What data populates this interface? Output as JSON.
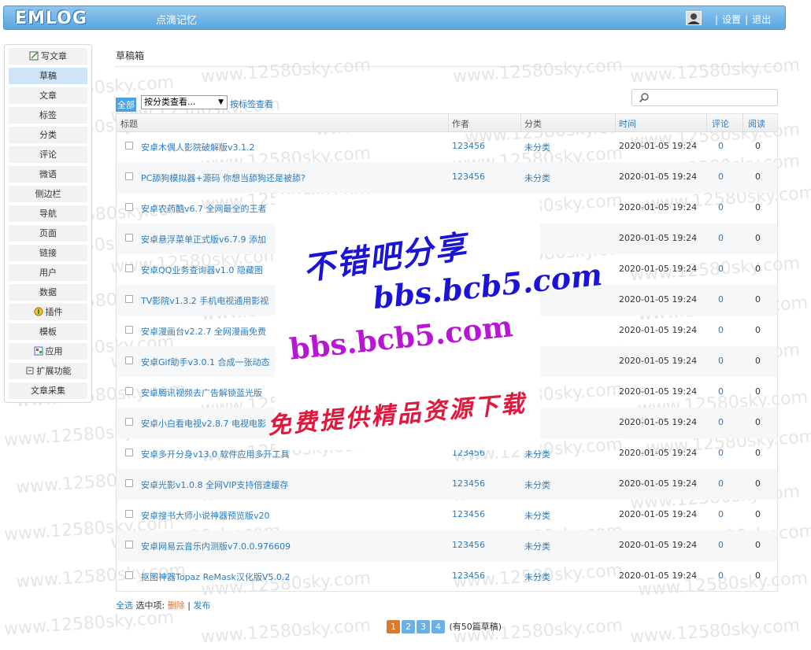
{
  "header": {
    "logo": "EMLOG",
    "site_name": "点滴记忆",
    "settings": "设置",
    "logout": "退出",
    "sep": "|"
  },
  "sidebar": {
    "items": [
      {
        "label": "写文章",
        "icon": "write-icon"
      },
      {
        "label": "草稿",
        "active": true
      },
      {
        "label": "文章"
      },
      {
        "label": "标签"
      },
      {
        "label": "分类"
      },
      {
        "label": "评论"
      },
      {
        "label": "微语"
      },
      {
        "label": "侧边栏"
      },
      {
        "label": "导航"
      },
      {
        "label": "页面"
      },
      {
        "label": "链接"
      },
      {
        "label": "用户"
      },
      {
        "label": "数据"
      },
      {
        "label": "插件",
        "icon": "plugin-icon"
      },
      {
        "label": "模板"
      },
      {
        "label": "应用",
        "icon": "app-icon"
      },
      {
        "label": "扩展功能",
        "icon": "collapse-icon"
      },
      {
        "label": "文章采集"
      }
    ]
  },
  "main": {
    "page_title": "草稿箱",
    "filter": {
      "all": "全部",
      "category_select": "按分类查看...",
      "tag_view": "按标签查看"
    },
    "table": {
      "headers": [
        "标题",
        "作者",
        "分类",
        "时间",
        "评论",
        "阅读"
      ],
      "rows": [
        {
          "title": "安卓木偶人影院破解版v3.1.2",
          "author": "123456",
          "category": "未分类",
          "time": "2020-01-05 19:24",
          "comments": "0",
          "views": "0"
        },
        {
          "title": "PC舔狗模拟器+源码 你想当舔狗还是被舔?",
          "author": "123456",
          "category": "未分类",
          "time": "2020-01-05 19:24",
          "comments": "0",
          "views": "0"
        },
        {
          "title": "安卓农药酷v6.7 全网最全的王者",
          "author": "",
          "category": "类",
          "time": "2020-01-05 19:24",
          "comments": "0",
          "views": "0"
        },
        {
          "title": "安卓悬浮菜单正式版v6.7.9 添加",
          "author": "",
          "category": "类",
          "time": "2020-01-05 19:24",
          "comments": "0",
          "views": "0"
        },
        {
          "title": "安卓QQ业务查询器v1.0 隐藏图",
          "author": "",
          "category": "类",
          "time": "2020-01-05 19:24",
          "comments": "0",
          "views": "0"
        },
        {
          "title": "TV影院v1.3.2 手机电视通用影视",
          "author": "",
          "category": "类",
          "time": "2020-01-05 19:24",
          "comments": "0",
          "views": "0"
        },
        {
          "title": "安卓漫画台v2.2.7 全网漫画免费",
          "author": "",
          "category": "类",
          "time": "2020-01-05 19:24",
          "comments": "0",
          "views": "0"
        },
        {
          "title": "安卓Gif助手v3.0.1 合成一张动态",
          "author": "",
          "category": "类",
          "time": "2020-01-05 19:24",
          "comments": "0",
          "views": "0"
        },
        {
          "title": "安卓腾讯视频去广告解锁蓝光版",
          "author": "",
          "category": "类",
          "time": "2020-01-05 19:24",
          "comments": "0",
          "views": "0"
        },
        {
          "title": "安卓小白看电视v2.8.7 电视电影",
          "author": "",
          "category": "类",
          "time": "2020-01-05 19:24",
          "comments": "0",
          "views": "0"
        },
        {
          "title": "安卓多开分身v13.0 软件应用多开工具",
          "author": "123456",
          "category": "未分类",
          "time": "2020-01-05 19:24",
          "comments": "0",
          "views": "0"
        },
        {
          "title": "安卓光影v1.0.8 全网VIP支持倍速缓存",
          "author": "123456",
          "category": "未分类",
          "time": "2020-01-05 19:24",
          "comments": "0",
          "views": "0"
        },
        {
          "title": "安卓搜书大师小说神器预览版v20",
          "author": "123456",
          "category": "未分类",
          "time": "2020-01-05 19:24",
          "comments": "0",
          "views": "0"
        },
        {
          "title": "安卓网易云音乐内测版v7.0.0.976609",
          "author": "123456",
          "category": "未分类",
          "time": "2020-01-05 19:24",
          "comments": "0",
          "views": "0"
        },
        {
          "title": "抠图神器Topaz ReMask汉化版V5.0.2",
          "author": "123456",
          "category": "未分类",
          "time": "2020-01-05 19:24",
          "comments": "0",
          "views": "0"
        }
      ]
    },
    "bulk": {
      "select_all": "全选",
      "selected": "选中项:",
      "delete": "删除",
      "sep": "|",
      "publish": "发布"
    },
    "pager": {
      "pages": [
        "1",
        "2",
        "3",
        "4"
      ],
      "summary": "(有50篇草稿)"
    }
  },
  "overlay": {
    "line1": "不错吧分享",
    "line2": "bbs.bcb5.com",
    "line3": "bbs.bcb5.com",
    "line4": "免费提供精品资源下载"
  },
  "watermark": "www.12580sky.com",
  "colors": {
    "header": "#5aa6df",
    "link": "#2a7bc0",
    "active": "#cfe5f7",
    "delete": "#e0703a",
    "page_current": "#d9782f"
  }
}
